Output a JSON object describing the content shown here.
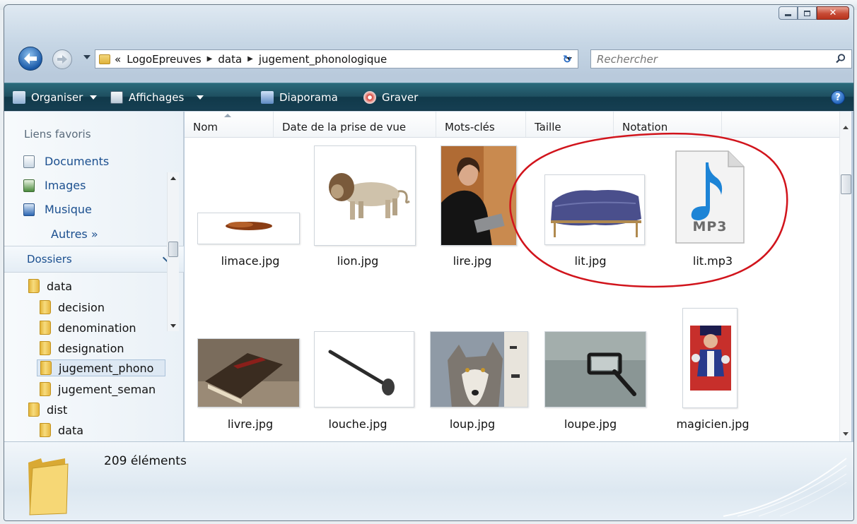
{
  "window": {
    "controls": {
      "minimize": "minimize",
      "maximize": "maximize",
      "close": "close"
    }
  },
  "address": {
    "overflow": "«",
    "segments": [
      "LogoEpreuves",
      "data",
      "jugement_phonologique"
    ]
  },
  "search": {
    "placeholder": "Rechercher"
  },
  "toolbar": {
    "organize": "Organiser",
    "views": "Affichages",
    "slideshow": "Diaporama",
    "burn": "Graver",
    "help": "?"
  },
  "sidebar": {
    "favorites_heading": "Liens favoris",
    "favorites": [
      "Documents",
      "Images",
      "Musique"
    ],
    "more": "Autres »",
    "folders_heading": "Dossiers",
    "tree": [
      {
        "label": "data",
        "level": 0
      },
      {
        "label": "decision",
        "level": 1
      },
      {
        "label": "denomination",
        "level": 1
      },
      {
        "label": "designation",
        "level": 1
      },
      {
        "label": "jugement_phono",
        "level": 1
      },
      {
        "label": "jugement_seman",
        "level": 1
      },
      {
        "label": "dist",
        "level": 0
      },
      {
        "label": "data",
        "level": 1
      }
    ]
  },
  "columns": [
    "Nom",
    "Date de la prise de vue",
    "Mots-clés",
    "Taille",
    "Notation"
  ],
  "files": [
    {
      "name": "limace.jpg"
    },
    {
      "name": "lion.jpg"
    },
    {
      "name": "lire.jpg"
    },
    {
      "name": "lit.jpg"
    },
    {
      "name": "lit.mp3",
      "badge": "MP3"
    },
    {
      "name": "livre.jpg"
    },
    {
      "name": "louche.jpg"
    },
    {
      "name": "loup.jpg"
    },
    {
      "name": "loupe.jpg"
    },
    {
      "name": "magicien.jpg"
    }
  ],
  "status": {
    "count": "209 éléments"
  },
  "colors": {
    "command_bar": "#1e4f60",
    "link": "#1b4f8f",
    "annotation": "#d1141c"
  }
}
